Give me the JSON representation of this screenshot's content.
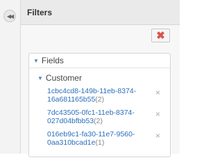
{
  "sidebar": {
    "collapse_glyph": "◀◀",
    "collapse_icon": "double-chevron-left-icon"
  },
  "panel": {
    "title": "Filters",
    "clear_glyph": "✖",
    "clear_icon": "clear-x-icon",
    "fields": {
      "label": "Fields",
      "caret": "▼",
      "group": {
        "label": "Customer",
        "caret": "▼",
        "items": [
          {
            "line1": "1cbc4cd8-149b-11eb-8374-",
            "line2": "16a681165b55",
            "count": "(2)"
          },
          {
            "line1": "7dc43505-0fc1-11eb-8374-",
            "line2": "027d04bfbb53",
            "count": "(2)"
          },
          {
            "line1": "016eb9c1-fa30-11e7-9560-",
            "line2": "0aa310bcad1e",
            "count": "(1)"
          }
        ],
        "remove_glyph": "×"
      }
    }
  },
  "colors": {
    "accent_link": "#2a6ebb",
    "clear_red": "#d9534f",
    "caret_blue": "#4a84c0"
  }
}
